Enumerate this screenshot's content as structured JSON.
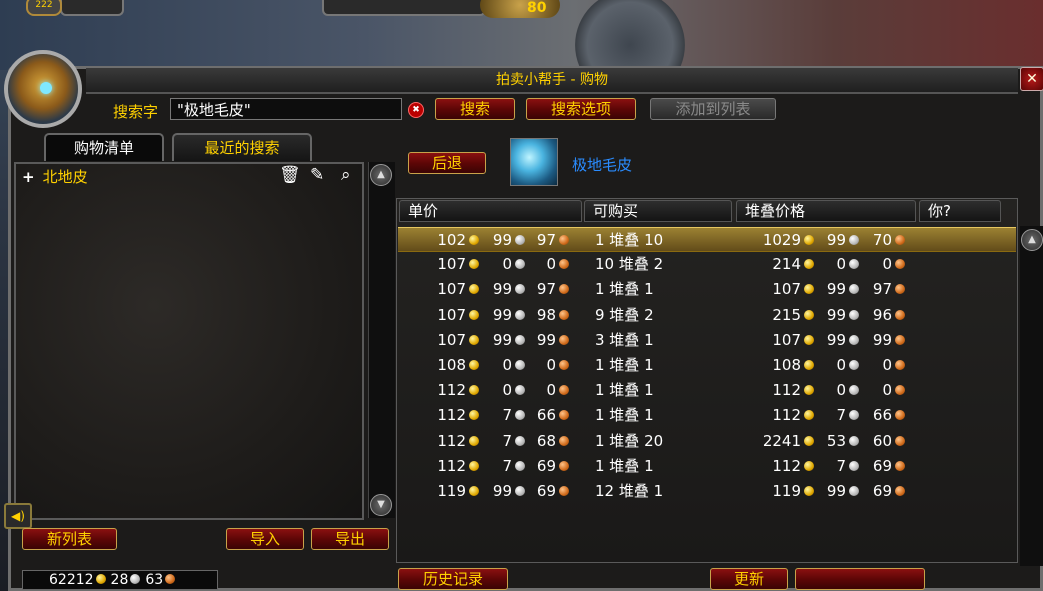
{
  "top": {
    "left_badge": "222",
    "level": "80"
  },
  "window": {
    "title": "拍卖小帮手 - 购物",
    "close_label": "✕"
  },
  "search": {
    "label": "搜索字",
    "value": "\"极地毛皮\"",
    "search_btn": "搜索",
    "options_btn": "搜索选项",
    "add_btn": "添加到列表"
  },
  "tabs": [
    {
      "label": "购物清单",
      "active": true
    },
    {
      "label": "最近的搜索",
      "active": false
    }
  ],
  "shopping_list": {
    "items": [
      {
        "label": "北地皮"
      }
    ]
  },
  "left_buttons": {
    "new_list": "新列表",
    "import": "导入",
    "export": "导出"
  },
  "money": {
    "gold": "62212",
    "silver": "28",
    "copper": "63"
  },
  "result": {
    "back_btn": "后退",
    "item_name": "极地毛皮"
  },
  "columns": [
    "单价",
    "可购买",
    "堆叠价格",
    "你?"
  ],
  "rows": [
    {
      "pg": "102",
      "ps": "99",
      "pc": "97",
      "stack": "1 堆叠 10",
      "sg": "1029",
      "ss": "99",
      "sc": "70",
      "selected": true
    },
    {
      "pg": "107",
      "ps": "0",
      "pc": "0",
      "stack": "10 堆叠 2",
      "sg": "214",
      "ss": "0",
      "sc": "0"
    },
    {
      "pg": "107",
      "ps": "99",
      "pc": "97",
      "stack": "1 堆叠 1",
      "sg": "107",
      "ss": "99",
      "sc": "97"
    },
    {
      "pg": "107",
      "ps": "99",
      "pc": "98",
      "stack": "9 堆叠 2",
      "sg": "215",
      "ss": "99",
      "sc": "96"
    },
    {
      "pg": "107",
      "ps": "99",
      "pc": "99",
      "stack": "3 堆叠 1",
      "sg": "107",
      "ss": "99",
      "sc": "99"
    },
    {
      "pg": "108",
      "ps": "0",
      "pc": "0",
      "stack": "1 堆叠 1",
      "sg": "108",
      "ss": "0",
      "sc": "0"
    },
    {
      "pg": "112",
      "ps": "0",
      "pc": "0",
      "stack": "1 堆叠 1",
      "sg": "112",
      "ss": "0",
      "sc": "0"
    },
    {
      "pg": "112",
      "ps": "7",
      "pc": "66",
      "stack": "1 堆叠 1",
      "sg": "112",
      "ss": "7",
      "sc": "66"
    },
    {
      "pg": "112",
      "ps": "7",
      "pc": "68",
      "stack": "1 堆叠 20",
      "sg": "2241",
      "ss": "53",
      "sc": "60"
    },
    {
      "pg": "112",
      "ps": "7",
      "pc": "69",
      "stack": "1 堆叠 1",
      "sg": "112",
      "ss": "7",
      "sc": "69"
    },
    {
      "pg": "119",
      "ps": "99",
      "pc": "69",
      "stack": "12 堆叠 1",
      "sg": "119",
      "ss": "99",
      "sc": "69"
    }
  ],
  "bottom": {
    "history": "历史记录",
    "refresh": "更新"
  },
  "icons": {
    "trash": "trash-icon",
    "edit": "pencil-icon",
    "search": "magnifier-icon",
    "speaker": "speaker-icon"
  },
  "colors": {
    "gold_text": "#ffd100",
    "item_quality": "#2a8cff",
    "button_red": "#8a1010",
    "selected_row": "#c8a23c"
  }
}
